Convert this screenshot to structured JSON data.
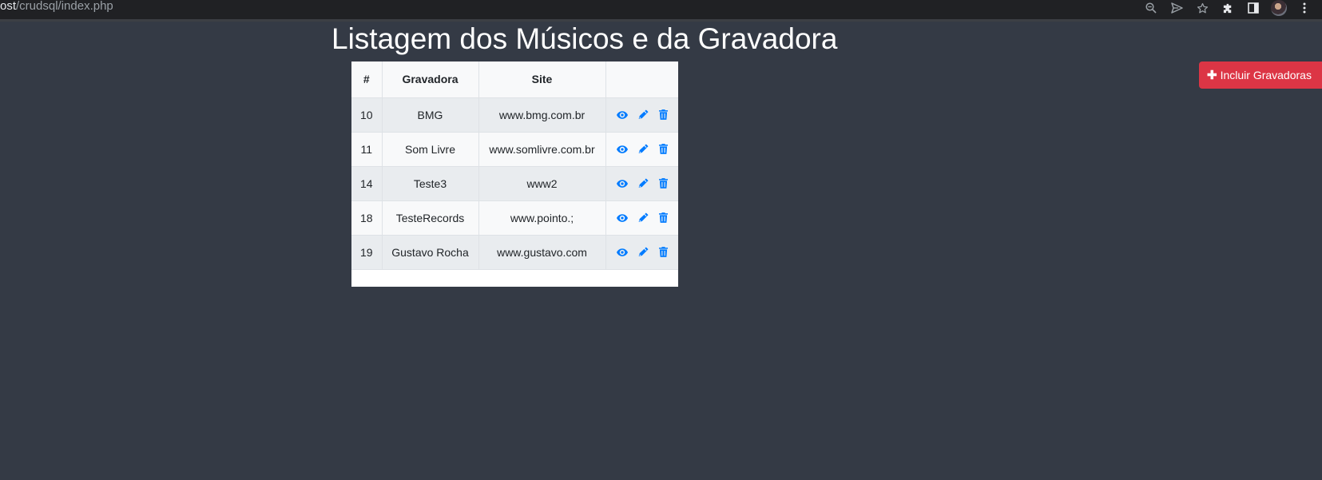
{
  "browser": {
    "url_host": "ost",
    "url_path": "/crudsql/index.php",
    "icons": [
      "zoom-out-icon",
      "send-icon",
      "star-icon",
      "extensions-icon",
      "side-panel-icon",
      "avatar",
      "more-icon"
    ]
  },
  "page": {
    "title": "Listagem dos Músicos e da Gravadora"
  },
  "add_button": {
    "icon": "plus-icon",
    "label": "Incluir Gravadoras",
    "color": "#dc3545"
  },
  "table": {
    "headers": [
      "#",
      "Gravadora",
      "Site",
      ""
    ],
    "rows": [
      {
        "id": "10",
        "gravadora": "BMG",
        "site": "www.bmg.com.br"
      },
      {
        "id": "11",
        "gravadora": "Som Livre",
        "site": "www.somlivre.com.br"
      },
      {
        "id": "14",
        "gravadora": "Teste3",
        "site": "www2"
      },
      {
        "id": "18",
        "gravadora": "TesteRecords",
        "site": "www.pointo.;"
      },
      {
        "id": "19",
        "gravadora": "Gustavo Rocha",
        "site": "www.gustavo.com"
      }
    ],
    "row_actions": [
      "view-icon",
      "edit-icon",
      "delete-icon"
    ],
    "action_color": "#007bff"
  },
  "colors": {
    "background": "#343a45",
    "browser_bar": "#202124"
  }
}
